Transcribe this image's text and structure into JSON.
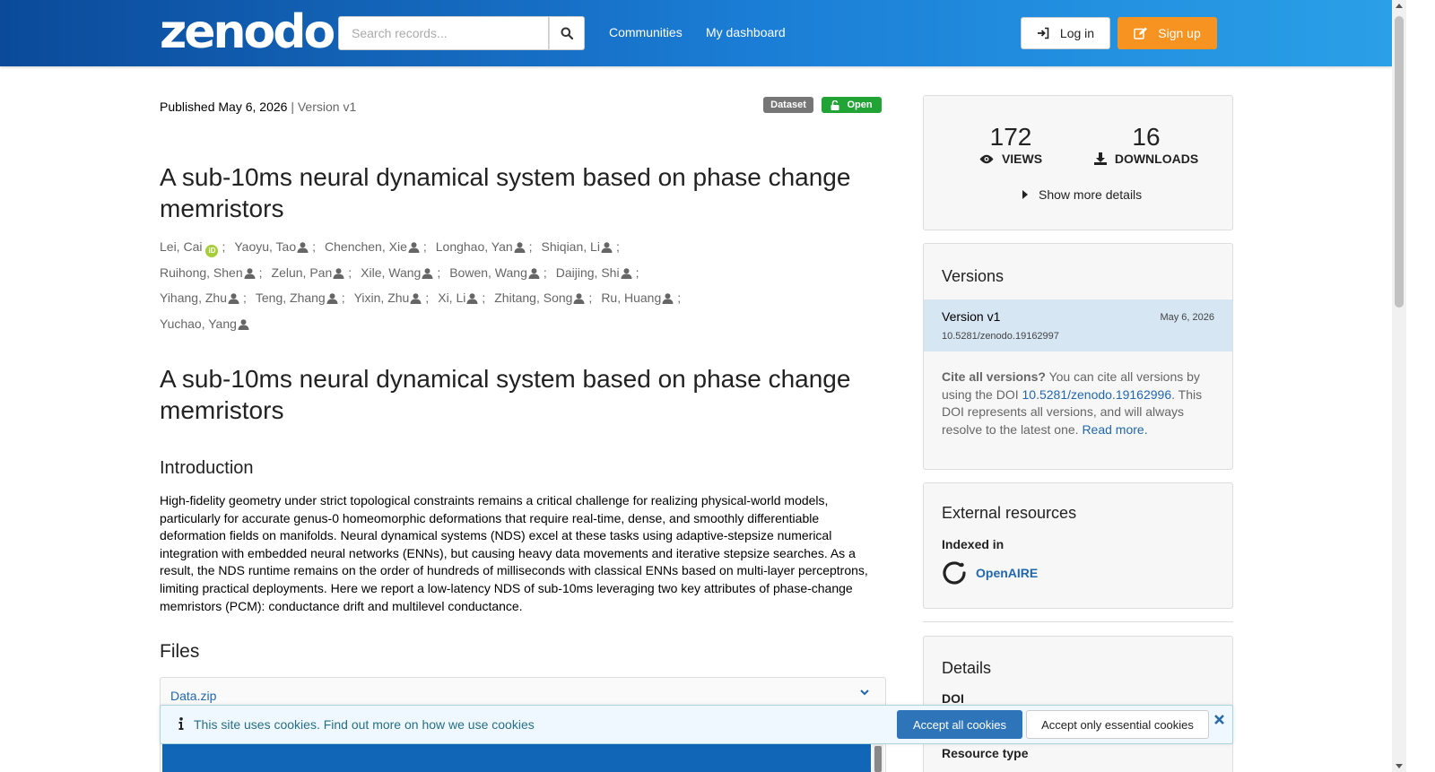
{
  "header": {
    "logo": "zenodo",
    "search_placeholder": "Search records...",
    "nav": [
      "Communities",
      "My dashboard"
    ],
    "login_label": "Log in",
    "signup_label": "Sign up"
  },
  "record": {
    "published": "Published May 6, 2026",
    "version_sep": " | ",
    "version": "Version v1",
    "badge_type": "Dataset",
    "badge_access": "Open",
    "title": "A sub-10ms neural dynamical system based on phase change memristors",
    "creators": [
      {
        "name": "Lei, Cai",
        "orcid": true
      },
      {
        "name": "Yaoyu, Tao"
      },
      {
        "name": "Chenchen, Xie"
      },
      {
        "name": "Longhao, Yan"
      },
      {
        "name": "Shiqian, Li"
      },
      {
        "name": "Ruihong, Shen"
      },
      {
        "name": "Zelun, Pan"
      },
      {
        "name": "Xile, Wang"
      },
      {
        "name": "Bowen, Wang"
      },
      {
        "name": "Daijing, Shi"
      },
      {
        "name": "Yihang, Zhu"
      },
      {
        "name": "Teng, Zhang"
      },
      {
        "name": "Yixin, Zhu"
      },
      {
        "name": "Xi, Li"
      },
      {
        "name": "Zhitang, Song"
      },
      {
        "name": "Ru, Huang"
      },
      {
        "name": "Yuchao, Yang"
      }
    ],
    "description_title": "A sub-10ms neural dynamical system based on phase change memristors",
    "intro_heading": "Introduction",
    "intro_text": "High-fidelity geometry under strict topological constraints remains a critical challenge for realizing physical-world models, particularly for accurate genus-0 homeomorphic deformations that require real-time, dense, and smoothly differentiable deformation fields on manifolds. Neural dynamical systems (NDS) excel at these tasks using adaptive-stepsize numerical integration with embedded neural networks (ENNs), but causing heavy data movements and iterative stepsize searches. As a result, the NDS runtime remains on the order of hundreds of milliseconds with classical ENNs based on multi-layer perceptrons,  limiting practical deployments. Here we report a low-latency NDS of sub-10ms leveraging two key attributes of phase-change memristors (PCM): conductance drift and multilevel conductance.",
    "files_heading": "Files",
    "file_name": "Data.zip"
  },
  "stats": {
    "views": "172",
    "views_label": "VIEWS",
    "downloads": "16",
    "downloads_label": "DOWNLOADS",
    "show_more": "Show more details"
  },
  "versions": {
    "heading": "Versions",
    "item_label": "Version v1",
    "item_date": "May 6, 2026",
    "item_doi": "10.5281/zenodo.19162997",
    "cite_bold": "Cite all versions?",
    "cite_text1": " You can cite all versions by using the DOI ",
    "cite_doi": "10.5281/zenodo.19162996",
    "cite_text2": ". This DOI represents all versions, and will always resolve to the latest one. ",
    "read_more": "Read more."
  },
  "external": {
    "heading": "External resources",
    "indexed_in": "Indexed in",
    "openaire": "OpenAIRE"
  },
  "details": {
    "heading": "Details",
    "doi_label": "DOI",
    "resource_type_label": "Resource type"
  },
  "cookie": {
    "text": "This site uses cookies. Find out more on ",
    "link": "how we use cookies",
    "accept_all": "Accept all cookies",
    "accept_essential": "Accept only essential cookies"
  },
  "colors": {
    "header_start": "#0b4a9a",
    "header_end": "#2aa0e8",
    "signup": "#f79421",
    "open_badge": "#21a336",
    "link": "#2167ae"
  }
}
